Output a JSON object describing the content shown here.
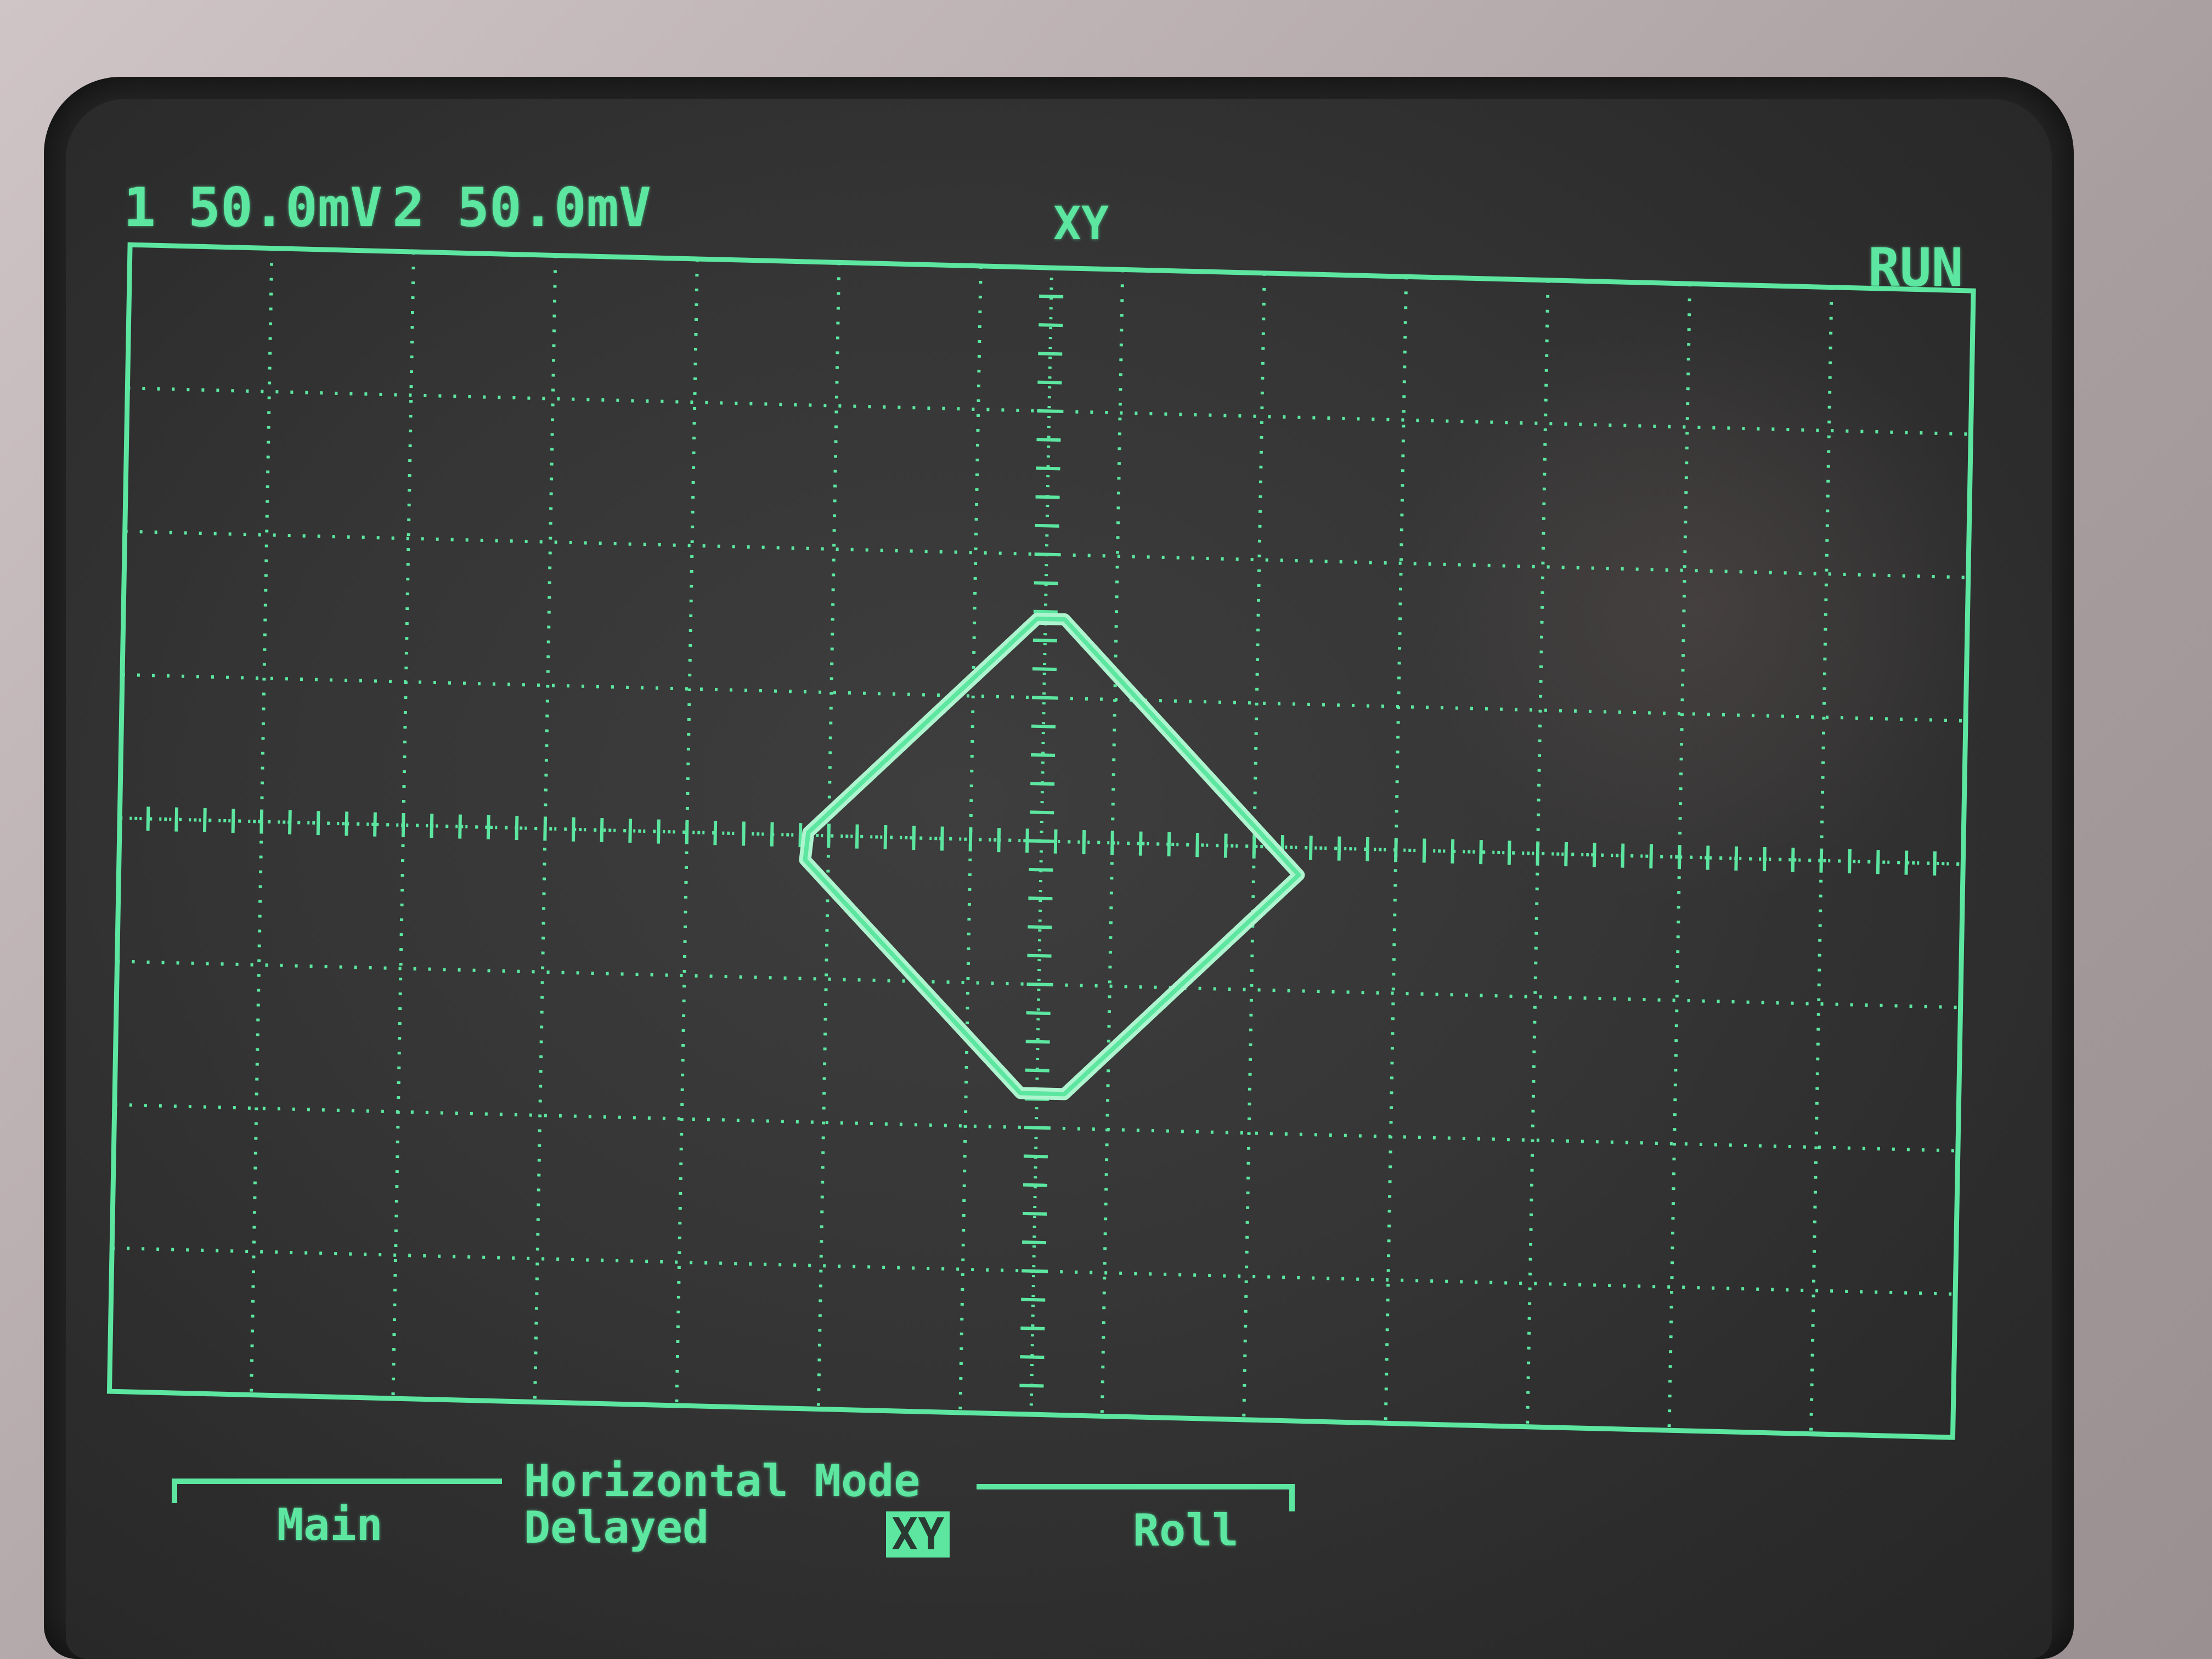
{
  "channels": {
    "ch1": "1 50.0mV",
    "ch2": "2 50.0mV"
  },
  "display": {
    "mode_title": "XY",
    "status": "RUN"
  },
  "softkeys": {
    "group_title": "Horizontal Mode",
    "options": [
      "Main",
      "Delayed",
      "XY",
      "Roll"
    ],
    "selected": "XY"
  },
  "colors": {
    "phosphor": "#5ce6a0",
    "screen": "#353535",
    "bezel": "#262626"
  },
  "trace": {
    "shape": "diamond",
    "description_visible": false
  }
}
